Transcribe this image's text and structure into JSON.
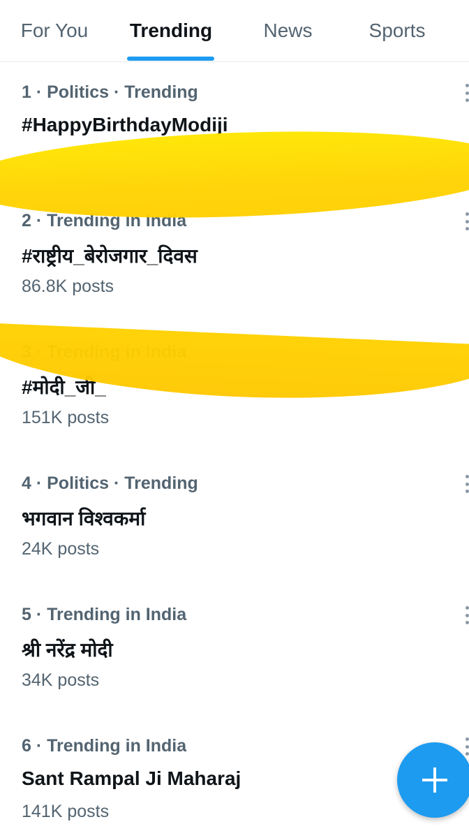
{
  "tabs": [
    {
      "label": "For You"
    },
    {
      "label": "Trending"
    },
    {
      "label": "News"
    },
    {
      "label": "Sports"
    }
  ],
  "active_tab": "Trending",
  "trends": [
    {
      "meta": "1 · Politics · Trending",
      "name": "#HappyBirthdayModiji",
      "count": ""
    },
    {
      "meta": "2 · Trending in India",
      "name": "#राष्ट्रीय_बेरोजगार_दिवस",
      "count": "86.8K posts"
    },
    {
      "meta": "3 · Trending in India",
      "name": "#मोदी_जी_",
      "count": "151K posts"
    },
    {
      "meta": "4 · Politics · Trending",
      "name": "भगवान विश्वकर्मा",
      "count": "24K posts"
    },
    {
      "meta": "5 · Trending in India",
      "name": "श्री नरेंद्र मोदी",
      "count": "34K posts"
    },
    {
      "meta": "6 · Trending in India",
      "name": "Sant Rampal Ji Maharaj",
      "count": "141K posts"
    }
  ],
  "colors": {
    "accent": "#1d9bf0",
    "highlight": "#ffd200",
    "secondary_text": "#536471"
  },
  "icons": {
    "fab": "plus-icon",
    "more": "more-vertical-icon"
  }
}
